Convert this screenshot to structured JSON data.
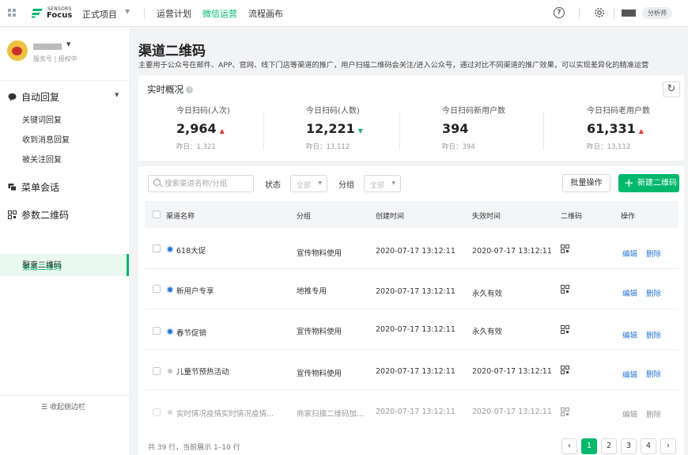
{
  "topbar": {
    "brand_small": "SENSORS",
    "brand_name": "Focus",
    "project": "正式项目",
    "nav": [
      "运营计划",
      "微信运营",
      "流程画布"
    ],
    "active_nav_index": 1,
    "role": "分析师",
    "accent": "#00b86b"
  },
  "sidebar": {
    "account_subtitle": "服务号 | 授权中",
    "groups": [
      {
        "label": "自动回复",
        "items": [
          "关键词回复",
          "收到消息回复",
          "被关注回复"
        ]
      },
      {
        "label": "菜单会话",
        "items": []
      },
      {
        "label": "参数二维码",
        "items": [
          "渠道二维码",
          "裂变二维码"
        ]
      }
    ],
    "active_item": "渠道二维码",
    "collapse_label": "收起侧边栏"
  },
  "main": {
    "title": "渠道二维码",
    "description": "主要用于公众号在邮件、APP、官网、线下门店等渠道的推广，用户扫描二维码会关注/进入公众号，通过对比不同渠道的推广效果，可以实现差异化的精准运营"
  },
  "realtime": {
    "title": "实时概况",
    "stats": [
      {
        "label": "今日扫码(人次)",
        "value": "2,964",
        "trend": "up",
        "yesterday": "昨日：1,321"
      },
      {
        "label": "今日扫码(人数)",
        "value": "12,221",
        "trend": "down",
        "yesterday": "昨日：13,112"
      },
      {
        "label": "今日扫码新用户数",
        "value": "394",
        "trend": "none",
        "yesterday": "昨日：394"
      },
      {
        "label": "今日扫码老用户数",
        "value": "61,331",
        "trend": "up",
        "yesterday": "昨日：13,112"
      }
    ]
  },
  "filters": {
    "search_placeholder": "搜索渠道名称/分组",
    "status_label": "状态",
    "status_value": "全部",
    "group_label": "分组",
    "group_value": "全部",
    "batch_label": "批量操作",
    "new_label": "新建二维码"
  },
  "table": {
    "columns": [
      "渠道名称",
      "分组",
      "创建时间",
      "失效时间",
      "二维码",
      "操作"
    ],
    "rows": [
      {
        "name": "618大促",
        "group": "宣传物料使用",
        "created": "2020-07-17 13:12:11",
        "expires": "2020-07-17 13:12:11",
        "edit": "编辑",
        "delete": "删除",
        "active": true
      },
      {
        "name": "新用户专享",
        "group": "地推专用",
        "created": "2020-07-17 13:12:11",
        "expires": "永久有效",
        "edit": "编辑",
        "delete": "删除",
        "active": true
      },
      {
        "name": "春节促销",
        "group": "宣传物料使用",
        "created": "2020-07-17 13:12:11",
        "expires": "永久有效",
        "edit": "编辑",
        "delete": "删除",
        "active": true
      },
      {
        "name": "儿童节预热活动",
        "group": "宣传物料使用",
        "created": "2020-07-17 13:12:11",
        "expires": "2020-07-17 13:12:11",
        "edit": "编辑",
        "delete": "删除",
        "active": false
      },
      {
        "name": "实时情况疫情实时情况疫情...",
        "group": "商家扫描二维码加...",
        "created": "2020-07-17 13:12:11",
        "expires": "2020-07-17 13:12:11",
        "edit": "编辑",
        "delete": "删除",
        "active": false,
        "faded": true
      }
    ],
    "summary": "共 39 行，当前展示 1–10 行",
    "pages": [
      "1",
      "2",
      "3",
      "4"
    ],
    "current_page": "1"
  }
}
